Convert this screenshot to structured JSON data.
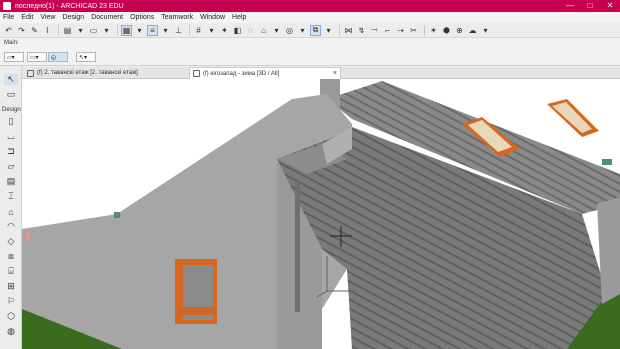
{
  "window": {
    "title": "последно(1) - ARCHICAD 23 EDU",
    "minimize": "—",
    "maximize": "□",
    "close": "✕"
  },
  "menu": [
    "File",
    "Edit",
    "View",
    "Design",
    "Document",
    "Options",
    "Teamwork",
    "Window",
    "Help"
  ],
  "infobox": {
    "label": "Main:"
  },
  "tabs": [
    {
      "label": "(f) 2. таванскi етаж [2. таванскi етаж]",
      "active": false
    },
    {
      "label": "(f) югозапад - зима [3D / All]",
      "active": true,
      "close": "×"
    }
  ],
  "toolbox": {
    "design_label": "Design"
  },
  "colors": {
    "titlebar": "#c8004f",
    "wall": "#a9a9a9",
    "roof": "#7d7d7d",
    "window_frame": "#d9661f",
    "ground": "#3a6b1f",
    "gutter": "#4f8f6f"
  }
}
